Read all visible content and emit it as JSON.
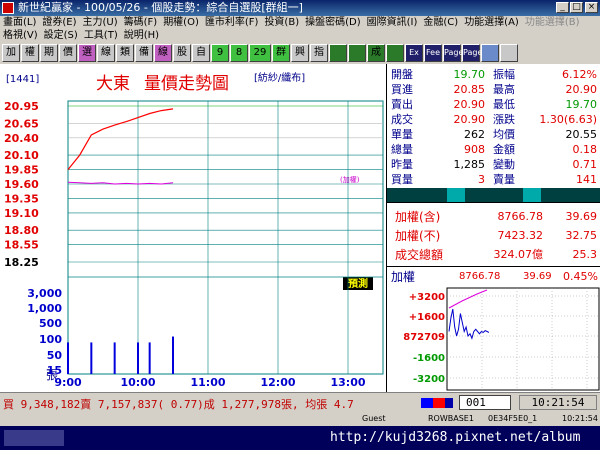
{
  "window": {
    "title": "新世紀贏家 - 100/05/26 - 個股走勢：綜合自選股[群組一]"
  },
  "menu": {
    "row1": [
      "畫面(L)",
      "證券(E)",
      "主力(U)",
      "籌碼(F)",
      "期權(O)",
      "匯市利率(F)",
      "投資(B)",
      "操盤密碼(D)",
      "國際資訊(I)",
      "金融(C)",
      "功能選擇(A)",
      "功能選擇(B)"
    ],
    "row2": [
      "格視(V)",
      "設定(S)",
      "工具(T)",
      "說明(H)"
    ]
  },
  "toolbar": {
    "buttons": [
      "加",
      "權",
      "期",
      "價",
      "選",
      "線",
      "類",
      "備",
      "線",
      "股",
      "自",
      "9",
      "8",
      "29",
      "群",
      "興",
      "指",
      "",
      "",
      "成",
      "",
      "Ex",
      "Fee",
      "Page",
      "Page",
      "",
      ""
    ]
  },
  "chart": {
    "code": "[1441]",
    "name": "大東",
    "title": "量價走勢圖",
    "category": "[紡紗/纖布]",
    "ref_label": "(加權)",
    "price_ticks": [
      "20.95",
      "20.65",
      "20.40",
      "20.10",
      "19.85",
      "19.60",
      "19.35",
      "19.10",
      "18.80",
      "18.55",
      "18.25"
    ],
    "volume_ticks": [
      "3,000",
      "1,000",
      "500",
      "100",
      "50",
      "15"
    ],
    "volume_unit": "張",
    "time_labels": [
      "9:00",
      "10:00",
      "11:00",
      "12:00",
      "13:00"
    ],
    "watch_label": "預測"
  },
  "chart_data": {
    "type": "line",
    "title": "量價走勢圖",
    "x": [
      "9:00",
      "9:10",
      "9:20",
      "9:30",
      "9:40",
      "9:50",
      "10:00",
      "10:10",
      "10:20",
      "10:30"
    ],
    "series": [
      {
        "values": [
          19.85,
          20.1,
          20.45,
          20.55,
          20.62,
          20.68,
          20.75,
          20.82,
          20.87,
          20.9
        ]
      }
    ],
    "index_line": [
      19.63,
      19.62,
      19.61,
      19.62,
      19.6,
      19.61,
      19.6,
      19.61,
      19.6,
      19.62
    ],
    "volume_x": [
      "9:00",
      "9:20",
      "9:40",
      "10:00",
      "10:10",
      "10:30"
    ],
    "volume": [
      100,
      100,
      100,
      100,
      100,
      150
    ],
    "ylim": [
      18.25,
      20.95
    ],
    "xlim": [
      "9:00",
      "13:30"
    ],
    "grid": true
  },
  "quote": {
    "rows": [
      {
        "l1": "開盤",
        "v1": "19.70",
        "l2": "振幅",
        "v2": "6.12%"
      },
      {
        "l1": "買進",
        "v1": "20.85",
        "l2": "最高",
        "v2": "20.90"
      },
      {
        "l1": "賣出",
        "v1": "20.90",
        "l2": "最低",
        "v2": "19.70"
      },
      {
        "l1": "成交",
        "v1": "20.90",
        "l2": "漲跌",
        "v2": "1.30(6.63)"
      },
      {
        "l1": "單量",
        "v1": "262",
        "l2": "均價",
        "v2": "20.55"
      },
      {
        "l1": "總量",
        "v1": "908",
        "l2": "金額",
        "v2": "0.18"
      },
      {
        "l1": "昨量",
        "v1": "1,285",
        "l2": "變動",
        "v2": "0.71"
      },
      {
        "l1": "買量",
        "v1": "3",
        "l2": "賣量",
        "v2": "141"
      }
    ]
  },
  "index": {
    "rows": [
      {
        "label": "加權(含)",
        "value": "8766.78",
        "change": "39.69"
      },
      {
        "label": "加權(不)",
        "value": "7423.32",
        "change": "32.75"
      },
      {
        "label": "成交總額",
        "value": "324.07億",
        "change": "25.3"
      }
    ]
  },
  "mini_chart": {
    "title": "加權",
    "value": "8766.78",
    "change": "39.69",
    "pct": "0.45%",
    "ticks": [
      "+3200",
      "+1600",
      "872709",
      "-1600",
      "-3200"
    ],
    "series": [
      30,
      60,
      80,
      40,
      20,
      35,
      70,
      50,
      30,
      40,
      20,
      25,
      15,
      30,
      35,
      30,
      25,
      30,
      28,
      32,
      30,
      28
    ]
  },
  "status": {
    "summary": "買 9,348,182賣 7,157,837( 0.77)成 1,277,978張, 均張 4.7",
    "code": "001",
    "time": "10:21:54",
    "line2": [
      "",
      "Guest",
      "ROWBASE1",
      "0E34F5E0_1",
      "10:21:54"
    ]
  },
  "taskbar": {
    "url": "http://kujd3268.pixnet.net/album"
  },
  "colors": {
    "price_line": "#ff0000",
    "index_line": "#dd00dd",
    "volume_bar": "#0000dd",
    "grid": "#008080"
  }
}
